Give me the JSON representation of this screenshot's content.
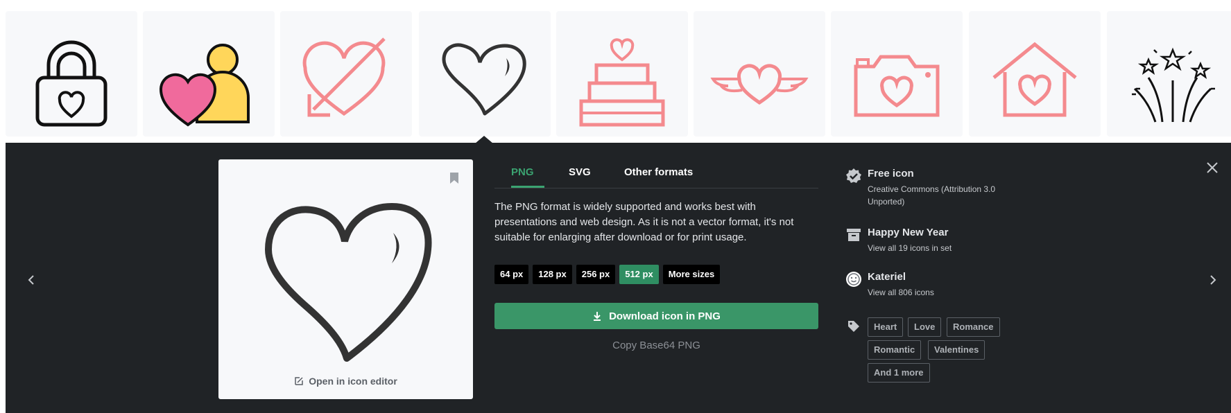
{
  "strip": {
    "icons": [
      "lock-heart-icon",
      "heart-person-icon",
      "heart-arrow-icon",
      "heart-outline-icon",
      "heart-cake-icon",
      "winged-heart-icon",
      "heart-camera-icon",
      "heart-house-icon",
      "fireworks-icon"
    ],
    "selected_index": 3,
    "colors": {
      "pink": "#f48a8e",
      "black": "#111111",
      "yellow": "#ffd65a",
      "magenta": "#f06a9c"
    }
  },
  "preview": {
    "icon": "heart-outline-icon",
    "editor_link": "Open in icon editor"
  },
  "tabs": [
    {
      "label": "PNG",
      "active": true
    },
    {
      "label": "SVG",
      "active": false
    },
    {
      "label": "Other formats",
      "active": false
    }
  ],
  "description": "The PNG format is widely supported and works best with presentations and web design. As it is not a vector format, it's not suitable for enlarging after download or for print usage.",
  "sizes": [
    {
      "label": "64 px",
      "active": false
    },
    {
      "label": "128 px",
      "active": false
    },
    {
      "label": "256 px",
      "active": false
    },
    {
      "label": "512 px",
      "active": true
    },
    {
      "label": "More sizes",
      "active": false
    }
  ],
  "download": {
    "label": "Download icon in PNG",
    "copy_label": "Copy Base64 PNG"
  },
  "meta": {
    "license": {
      "title": "Free icon",
      "subtitle": "Creative Commons (Attribution 3.0 Unported)"
    },
    "set": {
      "title": "Happy New Year",
      "subtitle": "View all 19 icons in set"
    },
    "author": {
      "title": "Kateriel",
      "subtitle": "View all 806 icons"
    }
  },
  "tags": [
    "Heart",
    "Love",
    "Romance",
    "Romantic",
    "Valentines",
    "And 1 more"
  ],
  "colors": {
    "panel": "#202326",
    "accent": "#3a9668",
    "tile": "#f7f8fa"
  }
}
